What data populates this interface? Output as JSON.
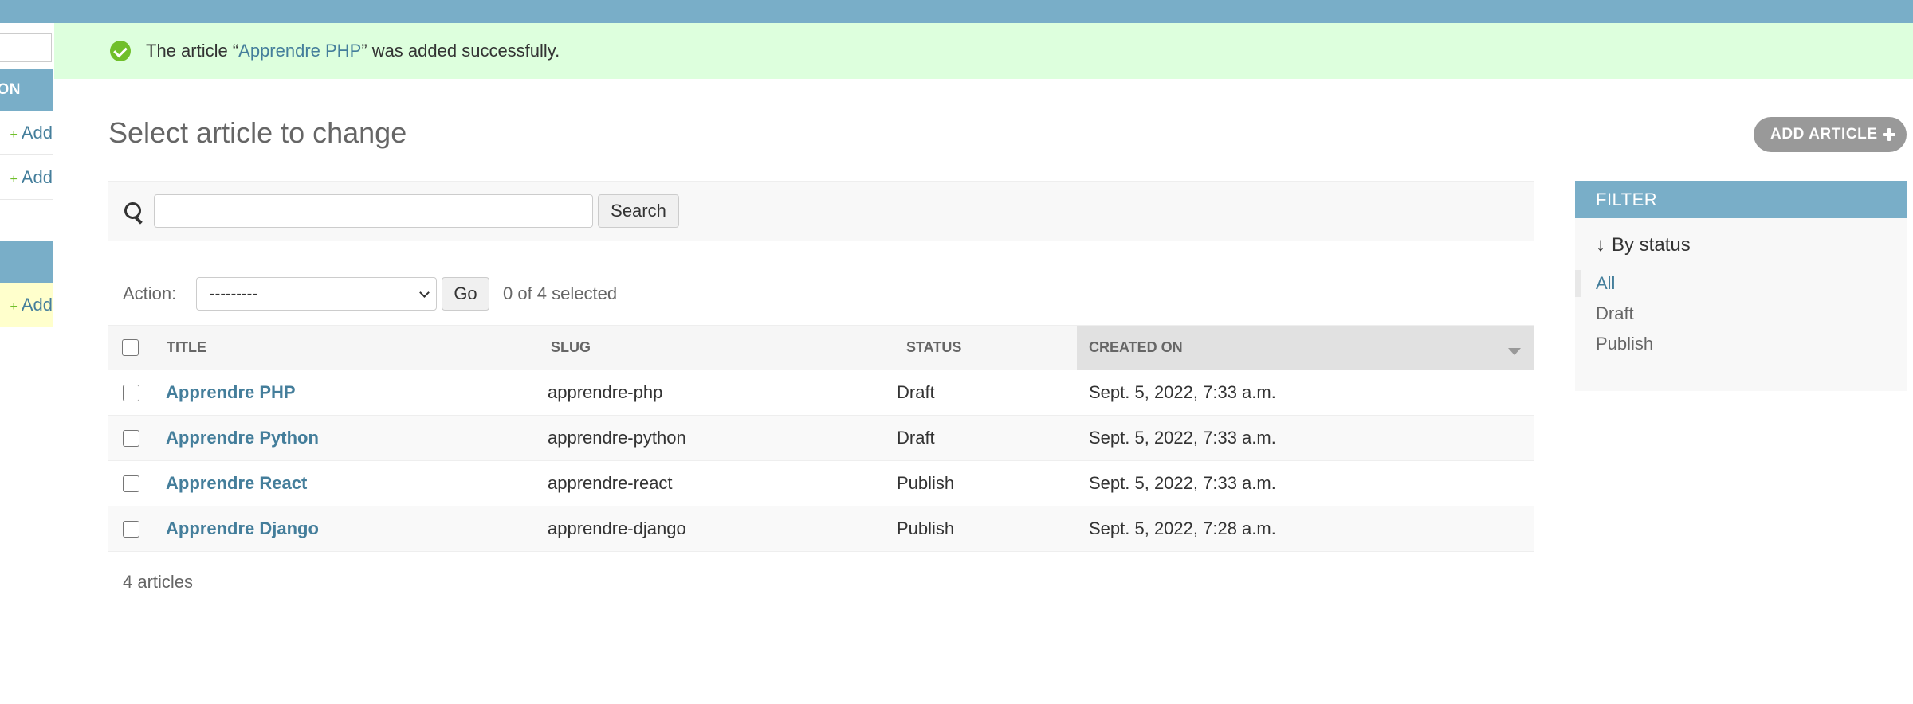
{
  "sidebar": {
    "caption_a": "ON",
    "add_label": "Add"
  },
  "message": {
    "before": "The article “",
    "link": "Apprendre PHP",
    "after": "” was added successfully."
  },
  "page_title": "Select article to change",
  "add_button": "Add article",
  "search": {
    "value": "",
    "button": "Search"
  },
  "actions": {
    "label": "Action:",
    "selected_option": "---------",
    "go": "Go",
    "selected_count": "0 of 4 selected"
  },
  "table": {
    "columns": [
      "Title",
      "Slug",
      "Status",
      "Created on"
    ],
    "rows": [
      {
        "title": "Apprendre PHP",
        "slug": "apprendre-php",
        "status": "Draft",
        "created": "Sept. 5, 2022, 7:33 a.m."
      },
      {
        "title": "Apprendre Python",
        "slug": "apprendre-python",
        "status": "Draft",
        "created": "Sept. 5, 2022, 7:33 a.m."
      },
      {
        "title": "Apprendre React",
        "slug": "apprendre-react",
        "status": "Publish",
        "created": "Sept. 5, 2022, 7:33 a.m."
      },
      {
        "title": "Apprendre Django",
        "slug": "apprendre-django",
        "status": "Publish",
        "created": "Sept. 5, 2022, 7:28 a.m."
      }
    ]
  },
  "paginator": "4 articles",
  "filter": {
    "heading": "Filter",
    "subtitle": "By status",
    "options": [
      "All",
      "Draft",
      "Publish"
    ]
  },
  "colors": {
    "header": "#79aec8",
    "link": "#447e9b",
    "success_bg": "#ddffdd",
    "success_icon": "#70bf2b"
  }
}
